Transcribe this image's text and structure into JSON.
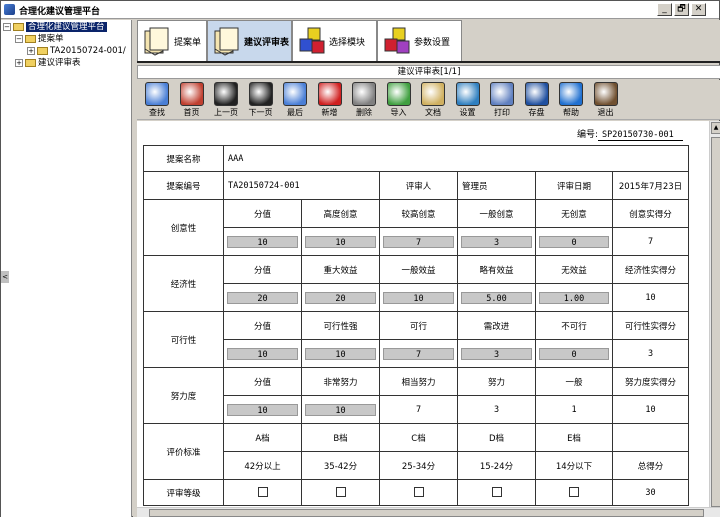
{
  "window": {
    "title": "合理化建议管理平台",
    "buttons": [
      "_",
      "🗗",
      "✕"
    ]
  },
  "tree": {
    "root": "合理化建议管理平台",
    "nodes": [
      {
        "label": "提案单",
        "level": 1
      },
      {
        "label": "TA20150724-001/",
        "level": 2
      },
      {
        "label": "建议评审表",
        "level": 1
      }
    ]
  },
  "modules": [
    {
      "label": "提案单",
      "icon": "proposal-icon"
    },
    {
      "label": "建议评审表",
      "icon": "review-icon"
    },
    {
      "label": "选择模块",
      "icon": "cubes-icon"
    },
    {
      "label": "参数设置",
      "icon": "settings-cubes-icon"
    }
  ],
  "doc_title": "建议评审表[1/1]",
  "toolbar": [
    {
      "label": "查找",
      "color": "#4a7fd6"
    },
    {
      "label": "首页",
      "color": "#c04030"
    },
    {
      "label": "上一页",
      "color": "#222222"
    },
    {
      "label": "下一页",
      "color": "#222222"
    },
    {
      "label": "最后",
      "color": "#4a7fd6"
    },
    {
      "label": "新增",
      "color": "#d02020"
    },
    {
      "label": "删除",
      "color": "#808080"
    },
    {
      "label": "导入",
      "color": "#40a040"
    },
    {
      "label": "文档",
      "color": "#d0b060"
    },
    {
      "label": "设置",
      "color": "#3080c0"
    },
    {
      "label": "打印",
      "color": "#6080c0"
    },
    {
      "label": "存盘",
      "color": "#2050a0"
    },
    {
      "label": "帮助",
      "color": "#2070d0"
    },
    {
      "label": "退出",
      "color": "#705030"
    }
  ],
  "form": {
    "no_label": "编号:",
    "no_value": "SP20150730-001",
    "name_label": "提案名称",
    "name_value": "AAA",
    "code_label": "提案编号",
    "code_value": "TA20150724-001",
    "reviewer_label": "评审人",
    "reviewer_value": "管理员",
    "date_label": "评审日期",
    "date_value": "2015年7月23日",
    "sections": [
      {
        "label": "创意性",
        "headers": [
          "分值",
          "高度创意",
          "较高创意",
          "一般创意",
          "无创意",
          "创意实得分"
        ],
        "values": [
          "10",
          "10",
          "7",
          "3",
          "0",
          "7"
        ]
      },
      {
        "label": "经济性",
        "headers": [
          "分值",
          "重大效益",
          "一般效益",
          "略有效益",
          "无效益",
          "经济性实得分"
        ],
        "values": [
          "20",
          "20",
          "10",
          "5.00",
          "1.00",
          "10"
        ]
      },
      {
        "label": "可行性",
        "headers": [
          "分值",
          "可行性强",
          "可行",
          "需改进",
          "不可行",
          "可行性实得分"
        ],
        "values": [
          "10",
          "10",
          "7",
          "3",
          "0",
          "3"
        ]
      },
      {
        "label": "努力度",
        "headers": [
          "分值",
          "非常努力",
          "相当努力",
          "努力",
          "一般",
          "努力度实得分"
        ],
        "values": [
          "10",
          "10",
          "7",
          "3",
          "1",
          "10"
        ]
      }
    ],
    "criteria": {
      "label": "评价标准",
      "grades": [
        "A档",
        "B档",
        "C档",
        "D档",
        "E档"
      ],
      "ranges": [
        "42分以上",
        "35-42分",
        "25-34分",
        "15-24分",
        "14分以下"
      ],
      "total_label": "总得分"
    },
    "level": {
      "label": "评审等级",
      "total": "30"
    }
  }
}
